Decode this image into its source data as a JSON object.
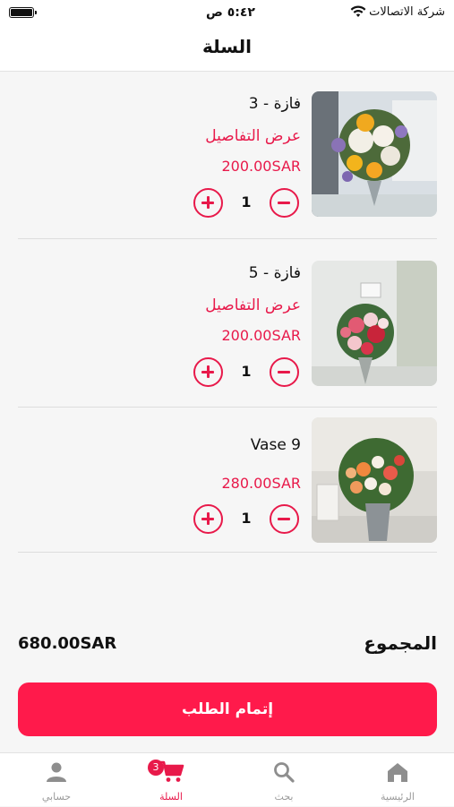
{
  "status_bar": {
    "carrier": "شركة الاتصالات",
    "time": "٥:٤٢ ص"
  },
  "header": {
    "title": "السلة"
  },
  "cart": {
    "items": [
      {
        "name": "فازة - 3",
        "details_label": "عرض التفاصيل",
        "price": "200.00SAR",
        "quantity": "1"
      },
      {
        "name": "فازة - 5",
        "details_label": "عرض التفاصيل",
        "price": "200.00SAR",
        "quantity": "1"
      },
      {
        "name": "Vase 9",
        "details_label": "",
        "price": "280.00SAR",
        "quantity": "1"
      }
    ]
  },
  "summary": {
    "total_label": "المجموع",
    "total_value": "680.00SAR"
  },
  "checkout_button": {
    "label": "إتمام الطلب"
  },
  "tab_bar": {
    "tabs": [
      {
        "label": "الرئيسية",
        "icon": "home-icon"
      },
      {
        "label": "بحث",
        "icon": "search-icon"
      },
      {
        "label": "السلة",
        "icon": "cart-icon",
        "badge": "3",
        "active": true
      },
      {
        "label": "حسابي",
        "icon": "user-icon"
      }
    ]
  },
  "colors": {
    "accent": "#e8194a",
    "button": "#ff1a4b"
  }
}
